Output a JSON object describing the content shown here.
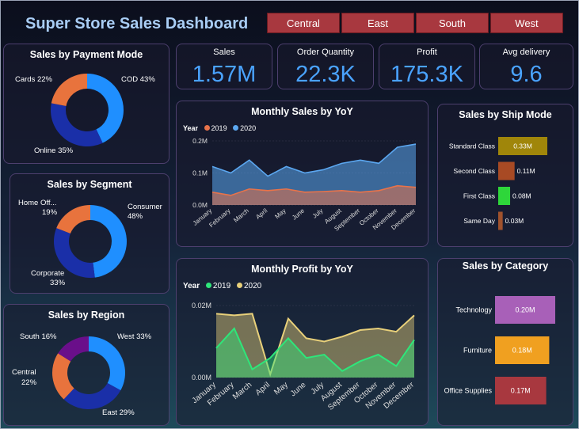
{
  "header": {
    "title": "Super Store Sales Dashboard",
    "regions": [
      "Central",
      "East",
      "South",
      "West"
    ]
  },
  "kpis": [
    {
      "label": "Sales",
      "value": "1.57M"
    },
    {
      "label": "Order Quantity",
      "value": "22.3K"
    },
    {
      "label": "Profit",
      "value": "175.3K"
    },
    {
      "label": "Avg delivery",
      "value": "9.6"
    }
  ],
  "colors": {
    "accent": "#4aa3ff",
    "region_button": "#a8383f",
    "series_2019_sales": "#e8734a",
    "series_2020_sales": "#5ba7f0",
    "series_2019_profit": "#2ee67a",
    "series_2020_profit": "#e8d07a"
  },
  "chart_data": [
    {
      "type": "pie",
      "title": "Sales by Payment Mode",
      "categories": [
        "COD",
        "Online",
        "Cards"
      ],
      "values": [
        43,
        35,
        22
      ],
      "labels": [
        "COD 43%",
        "Online 35%",
        "Cards 22%"
      ],
      "colors": [
        "#1f8fff",
        "#1a2fa8",
        "#e8733d"
      ]
    },
    {
      "type": "pie",
      "title": "Sales by Segment",
      "categories": [
        "Consumer",
        "Corporate",
        "Home Office"
      ],
      "values": [
        48,
        33,
        19
      ],
      "labels": [
        "Consumer",
        "Corporate",
        "Home Off..."
      ],
      "percents": [
        "48%",
        "33%",
        "19%"
      ],
      "colors": [
        "#1f8fff",
        "#1a2fa8",
        "#e8733d"
      ]
    },
    {
      "type": "pie",
      "title": "Sales by Region",
      "categories": [
        "West",
        "East",
        "Central",
        "South"
      ],
      "values": [
        33,
        29,
        22,
        16
      ],
      "labels": [
        "West 33%",
        "East 29%",
        "Central",
        "South 16%"
      ],
      "percents": [
        "",
        "",
        "22%",
        ""
      ],
      "colors": [
        "#1f8fff",
        "#1a2fa8",
        "#e8733d",
        "#6a0f8a"
      ]
    },
    {
      "type": "area",
      "title": "Monthly Sales by YoY",
      "legend_title": "Year",
      "categories": [
        "January",
        "February",
        "March",
        "April",
        "May",
        "June",
        "July",
        "August",
        "September",
        "October",
        "November",
        "December"
      ],
      "series": [
        {
          "name": "2019",
          "color": "#e8734a",
          "values": [
            0.04,
            0.03,
            0.05,
            0.045,
            0.05,
            0.04,
            0.042,
            0.045,
            0.04,
            0.045,
            0.06,
            0.055
          ]
        },
        {
          "name": "2020",
          "color": "#5ba7f0",
          "values": [
            0.12,
            0.1,
            0.14,
            0.09,
            0.12,
            0.1,
            0.11,
            0.13,
            0.14,
            0.13,
            0.18,
            0.19
          ]
        }
      ],
      "yticks": [
        "0.0M",
        "0.1M",
        "0.2M"
      ],
      "ylim": [
        0,
        0.2
      ]
    },
    {
      "type": "area",
      "title": "Monthly Profit by YoY",
      "legend_title": "Year",
      "categories": [
        "January",
        "February",
        "March",
        "April",
        "May",
        "June",
        "July",
        "August",
        "September",
        "October",
        "November",
        "December"
      ],
      "series": [
        {
          "name": "2019",
          "color": "#2ee67a",
          "values": [
            0.009,
            0.015,
            0.0025,
            0.006,
            0.012,
            0.006,
            0.007,
            0.002,
            0.005,
            0.007,
            0.0035,
            0.0115
          ]
        },
        {
          "name": "2020",
          "color": "#e8d07a",
          "values": [
            0.0195,
            0.019,
            0.0195,
            0.001,
            0.018,
            0.012,
            0.011,
            0.0125,
            0.0145,
            0.015,
            0.014,
            0.019
          ]
        }
      ],
      "yticks": [
        "0.00M",
        "0.02M"
      ],
      "ylim": [
        0,
        0.022
      ]
    },
    {
      "type": "bar",
      "title": "Sales by Ship Mode",
      "categories": [
        "Standard Class",
        "Second Class",
        "First Class",
        "Same Day"
      ],
      "values": [
        0.33,
        0.11,
        0.08,
        0.03
      ],
      "labels": [
        "0.33M",
        "0.11M",
        "0.08M",
        "0.03M"
      ],
      "colors": [
        "#a0860a",
        "#a84a24",
        "#2ed63a",
        "#a0522d"
      ],
      "xlim": [
        0,
        0.33
      ]
    },
    {
      "type": "bar",
      "title": "Sales by Category",
      "categories": [
        "Technology",
        "Furniture",
        "Office Supplies"
      ],
      "values": [
        0.2,
        0.18,
        0.17
      ],
      "labels": [
        "0.20M",
        "0.18M",
        "0.17M"
      ],
      "colors": [
        "#a860b8",
        "#f0a020",
        "#a8383f"
      ],
      "xlim": [
        0,
        0.2
      ]
    }
  ]
}
